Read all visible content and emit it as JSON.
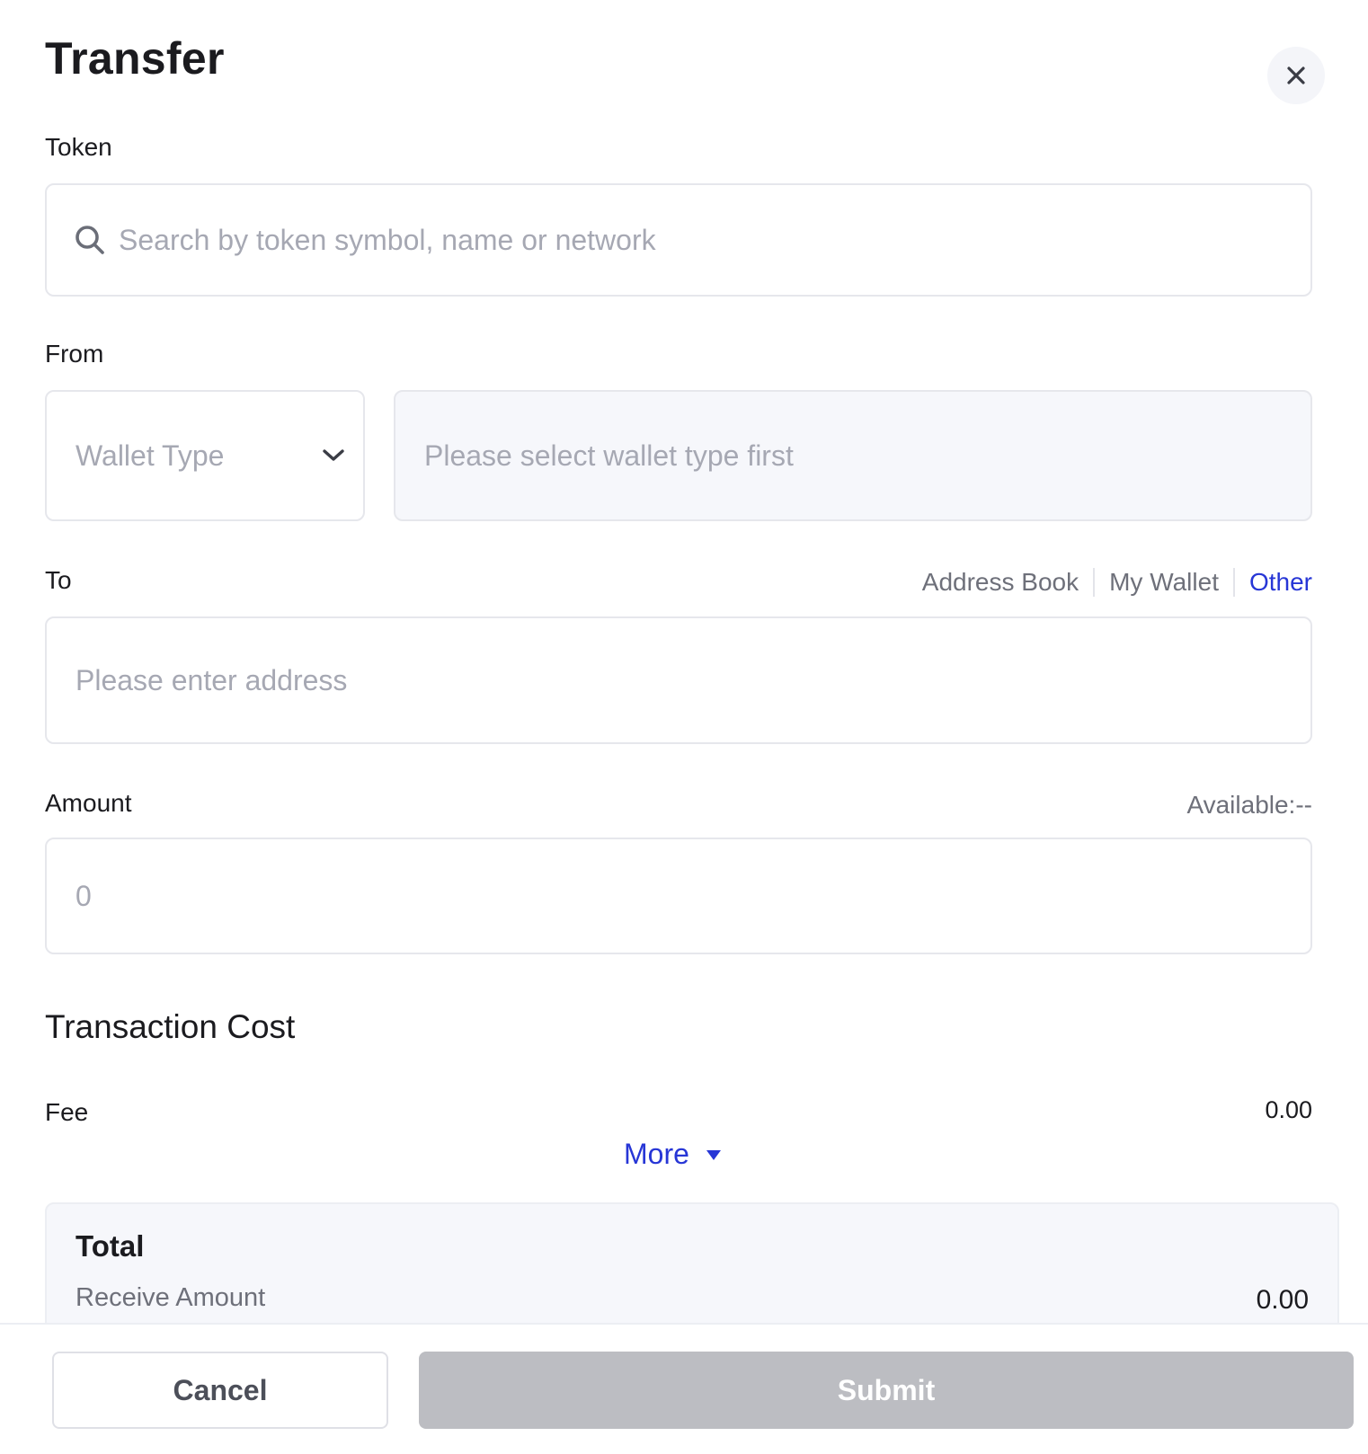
{
  "dialog": {
    "title": "Transfer"
  },
  "token": {
    "label": "Token",
    "placeholder": "Search by token symbol, name or network"
  },
  "from": {
    "label": "From",
    "wallet_type_placeholder": "Wallet Type",
    "wallet_placeholder": "Please select wallet type first"
  },
  "to": {
    "label": "To",
    "tabs": [
      {
        "label": "Address Book",
        "active": false
      },
      {
        "label": "My Wallet",
        "active": false
      },
      {
        "label": "Other",
        "active": true
      }
    ],
    "placeholder": "Please enter address"
  },
  "amount": {
    "label": "Amount",
    "available": "Available:--",
    "placeholder": "0"
  },
  "transaction_cost": {
    "title": "Transaction Cost",
    "fee_label": "Fee",
    "fee_value": "0.00",
    "more_label": "More"
  },
  "total": {
    "title": "Total",
    "receive_label": "Receive Amount",
    "receive_value": "0.00"
  },
  "footer": {
    "cancel_label": "Cancel",
    "submit_label": "Submit"
  },
  "colors": {
    "accent": "#2736d6",
    "submit_disabled": "#bcbdc2"
  },
  "icons": [
    "close-icon",
    "search-icon",
    "chevron-down-icon",
    "caret-down-icon"
  ]
}
